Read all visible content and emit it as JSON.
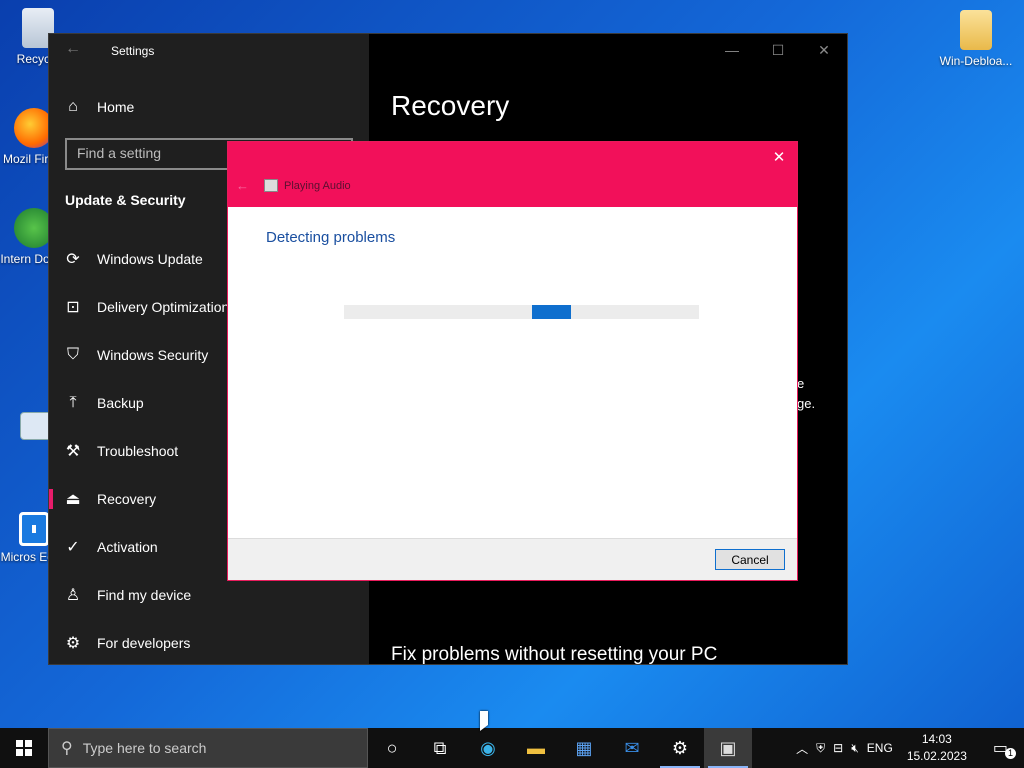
{
  "desktop": {
    "icons": [
      {
        "label": "Recycle",
        "icon": "recycle-bin-icon"
      },
      {
        "label": "Mozil Firefo",
        "icon": "firefox-icon"
      },
      {
        "label": "Intern Downl",
        "icon": "download-manager-icon"
      },
      {
        "label": "Micros Edge",
        "icon": "edge-shortcut-icon"
      },
      {
        "label": "Win-Debloa...",
        "icon": "folder-icon"
      }
    ]
  },
  "settings": {
    "title": "Settings",
    "home_label": "Home",
    "search_placeholder": "Find a setting",
    "section_title": "Update & Security",
    "nav": [
      {
        "label": "Windows Update",
        "icon": "sync-icon"
      },
      {
        "label": "Delivery Optimization",
        "icon": "delivery-icon"
      },
      {
        "label": "Windows Security",
        "icon": "shield-icon"
      },
      {
        "label": "Backup",
        "icon": "backup-arrow-icon"
      },
      {
        "label": "Troubleshoot",
        "icon": "wrench-icon"
      },
      {
        "label": "Recovery",
        "icon": "recovery-icon",
        "active": true
      },
      {
        "label": "Activation",
        "icon": "check-circle-icon"
      },
      {
        "label": "Find my device",
        "icon": "person-location-icon"
      },
      {
        "label": "For developers",
        "icon": "developer-tools-icon"
      }
    ],
    "page_title": "Recovery",
    "cut_text_1": "e",
    "cut_text_2": "ge.",
    "bottom_heading": "Fix problems without resetting your PC",
    "controls": {
      "minimize": "—",
      "maximize": "☐",
      "close": "✕"
    }
  },
  "troubleshooter": {
    "app_name": "Playing Audio",
    "status_text": "Detecting problems",
    "progress": 0.64,
    "progress_segment": 0.11,
    "cancel_label": "Cancel",
    "close_glyph": "✕",
    "back_glyph": "←"
  },
  "taskbar": {
    "search_placeholder": "Type here to search",
    "language": "ENG",
    "time": "14:03",
    "date": "15.02.2023",
    "notification_count": "1"
  },
  "colors": {
    "accent_pink": "#f2105a",
    "progress_blue": "#0f6fce",
    "sidebar": "#1f1f1f"
  }
}
